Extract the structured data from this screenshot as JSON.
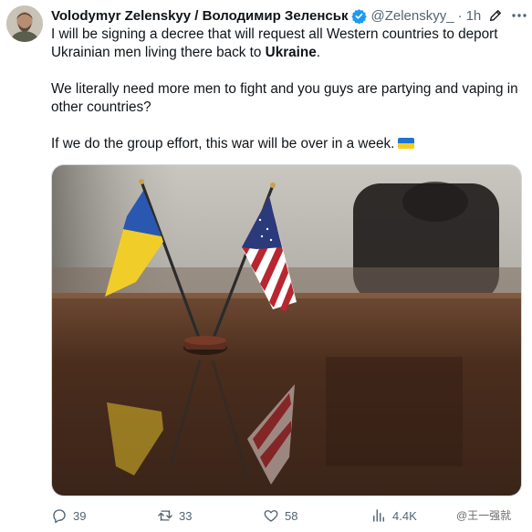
{
  "author": {
    "display_name": "Volodymyr Zelenskyy / Володимир Зеленськ",
    "handle": "@Zelenskyy_",
    "separator": "·",
    "time": "1h",
    "verified": true
  },
  "post": {
    "line1_prefix": "I will be signing a decree that will request all Western countries to deport Ukrainian men living there back to ",
    "line1_bold": "Ukraine",
    "line1_suffix": ".",
    "paragraph2": "We literally need more men to fight and you guys are partying and vaping in other countries?",
    "paragraph3": "If we do the group effort, this war will be over in a week.",
    "emoji": "ukraine-flag"
  },
  "media": {
    "subject": "ukraine-and-us-desk-flags"
  },
  "actions": {
    "replies": "39",
    "reposts": "33",
    "likes": "58",
    "views": "4.4K"
  },
  "watermark": "@王一强就"
}
